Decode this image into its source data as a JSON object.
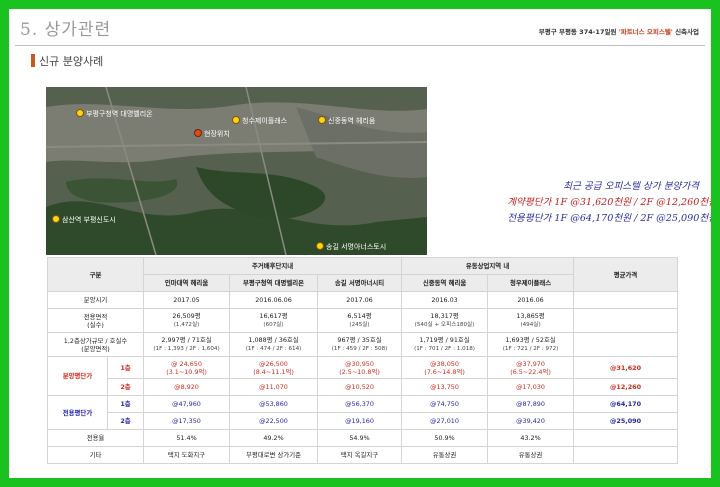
{
  "header": {
    "section_title": "5. 상가관련",
    "right_prefix": "부평구 부평동 374-17일원",
    "right_highlight": "'파트너스 오피스텔'",
    "right_suffix": "신축사업",
    "subtitle": "신규 분양사례"
  },
  "map": {
    "labels": [
      "부평구청역 대명벨리온",
      "현장위치",
      "청수제이플래스",
      "신중동역 헤리움",
      "삼산역 부평신도시",
      "송길 서명아너스토시"
    ]
  },
  "promo": {
    "title": "최근 공급 오피스텔 상가 분양가격",
    "line1": "계약평단가 1F @31,620천원  /  2F @12,260천원",
    "line2": "전용평단가 1F @64,170천원  /  2F @25,090천원"
  },
  "table": {
    "header": {
      "gubun": "구분",
      "group1": "주거배후단지내",
      "group2": "유동상업지역 내",
      "avg": "평균가격",
      "cols": [
        "인마대역 헤리움",
        "부평구청역 대명벨리온",
        "송길 서명아너시티",
        "신중동역 헤리움",
        "청우제이플래스"
      ]
    },
    "rows": {
      "bunyang_label": "분양시기",
      "bunyang": [
        "2017.05",
        "2016.06.06",
        "2017.06",
        "2016.03",
        "2016.06"
      ],
      "area_label1": "전용면적",
      "area_label2": "(실수)",
      "area_main": [
        "26,509평",
        "16,617평",
        "6,514평",
        "18,317평",
        "13,865평"
      ],
      "area_sub": [
        "(1,472실)",
        "(607실)",
        "(245실)",
        "(540실 + 오피스180실)",
        "(494실)"
      ],
      "scale_label1": "1,2층상가규모 / 호실수",
      "scale_label2": "(분양면적)",
      "scale_main": [
        "2,997평 / 71호실",
        "1,088평 / 36호실",
        "967평 / 35호실",
        "1,719평 / 91호실",
        "1,693평 / 52호실"
      ],
      "scale_sub": [
        "(1F : 1,393 / 2F : 1,604)",
        "(1F : 474 / 2F : 614)",
        "(1F : 459 / 2F : 508)",
        "(1F : 701 / 2F : 1,018)",
        "(1F : 721 / 2F : 972)"
      ],
      "price_label": "분양평단가",
      "use_label": "전용평단가",
      "floor1": "1층",
      "floor2": "2층",
      "price1_main": [
        "@ 24,650",
        "@26,500",
        "@30,950",
        "@38,050",
        "@37,970"
      ],
      "price1_sub": [
        "(3.1~10.9억)",
        "(8.4~11.1억)",
        "(2.5~10.8억)",
        "(7.6~14.8억)",
        "(6.5~22.4억)"
      ],
      "price1_avg": "@31,620",
      "price2": [
        "@8,920",
        "@11,070",
        "@10,520",
        "@13,750",
        "@17,030"
      ],
      "price2_avg": "@12,260",
      "use1": [
        "@47,960",
        "@53,860",
        "@56,370",
        "@74,750",
        "@87,890"
      ],
      "use1_avg": "@64,170",
      "use2": [
        "@17,350",
        "@22,500",
        "@19,160",
        "@27,010",
        "@39,420"
      ],
      "use2_avg": "@25,090",
      "ratio_label": "전용율",
      "ratio": [
        "51.4%",
        "49.2%",
        "54.9%",
        "50.9%",
        "43.2%"
      ],
      "etc_label": "기타",
      "etc": [
        "택지 도화지구",
        "부평대로변 상가기준",
        "택지 옥길지구",
        "유통상권",
        "유통상권"
      ]
    }
  }
}
